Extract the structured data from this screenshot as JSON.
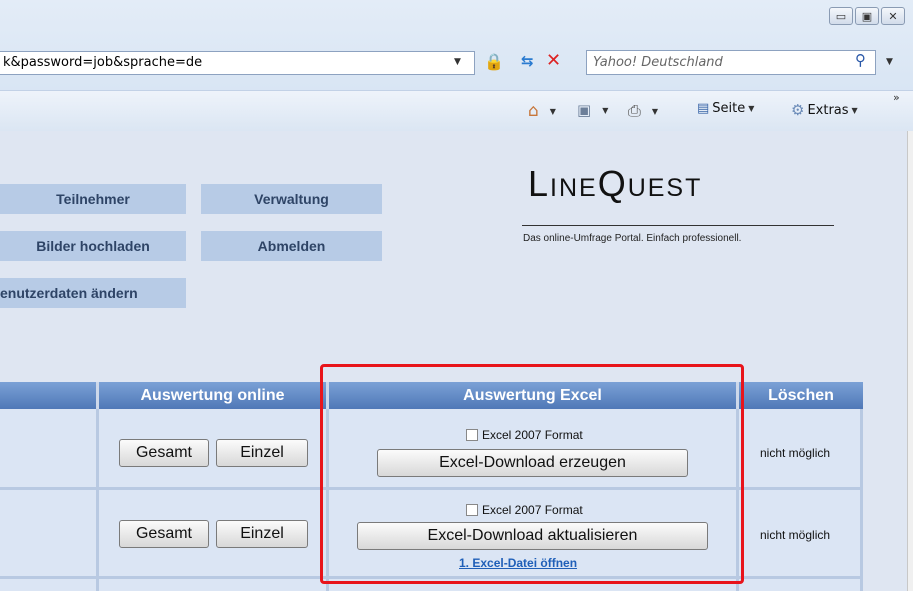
{
  "browser": {
    "address": "k&password=job&sprache=de",
    "search_placeholder": "Yahoo! Deutschland",
    "toolbar": {
      "page_label": "Seite",
      "tools_label": "Extras"
    }
  },
  "nav": {
    "participants": "Teilnehmer",
    "admin": "Verwaltung",
    "upload_images": "Bilder hochladen",
    "logout": "Abmelden",
    "change_user_data": "enutzerdaten ändern"
  },
  "logo": {
    "title": "LineQuest",
    "tagline": "Das online-Umfrage Portal. Einfach professionell."
  },
  "table": {
    "headers": {
      "online": "Auswertung online",
      "excel": "Auswertung Excel",
      "delete": "Löschen"
    },
    "rows": [
      {
        "total": "Gesamt",
        "single": "Einzel",
        "excel2007": "Excel 2007 Format",
        "download": "Excel-Download erzeugen",
        "delete_status": "nicht möglich"
      },
      {
        "total": "Gesamt",
        "single": "Einzel",
        "excel2007": "Excel 2007 Format",
        "download": "Excel-Download aktualisieren",
        "open_link": "1. Excel-Datei öffnen",
        "delete_status": "nicht möglich"
      }
    ]
  },
  "colors": {
    "highlight": "#e8141b",
    "header": "#5b84c0",
    "nav_button": "#b7cbe6"
  }
}
